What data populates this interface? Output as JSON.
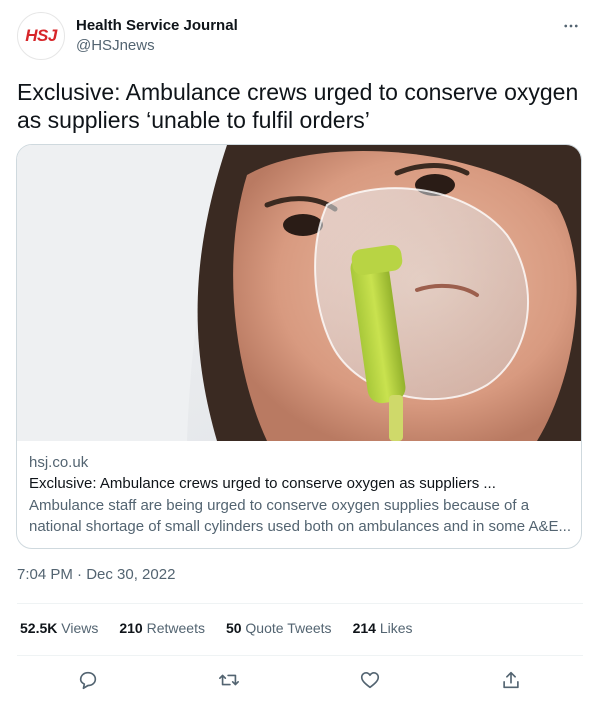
{
  "author": {
    "avatar_text": "HSJ",
    "display_name": "Health Service Journal",
    "handle": "@HSJnews"
  },
  "tweet": {
    "text": "Exclusive: Ambulance crews urged to conserve oxygen as suppliers ‘unable to fulfil orders’",
    "timestamp": "7:04 PM · Dec 30, 2022"
  },
  "card": {
    "domain": "hsj.co.uk",
    "title": "Exclusive: Ambulance crews urged to conserve oxygen as suppliers ...",
    "description": "Ambulance staff are being urged to conserve oxygen supplies because of a national shortage of small cylinders used both on ambulances and in some A&E..."
  },
  "stats": {
    "views_value": "52.5K",
    "views_label": "Views",
    "retweets_value": "210",
    "retweets_label": "Retweets",
    "quotes_value": "50",
    "quotes_label": "Quote Tweets",
    "likes_value": "214",
    "likes_label": "Likes"
  },
  "icons": {
    "more": "more-horizontal-icon",
    "reply": "reply-icon",
    "retweet": "retweet-icon",
    "like": "heart-icon",
    "share": "share-icon"
  },
  "colors": {
    "brand_red": "#d7262a",
    "text_primary": "#0f1419",
    "text_secondary": "#536471",
    "border": "#cfd9de"
  }
}
